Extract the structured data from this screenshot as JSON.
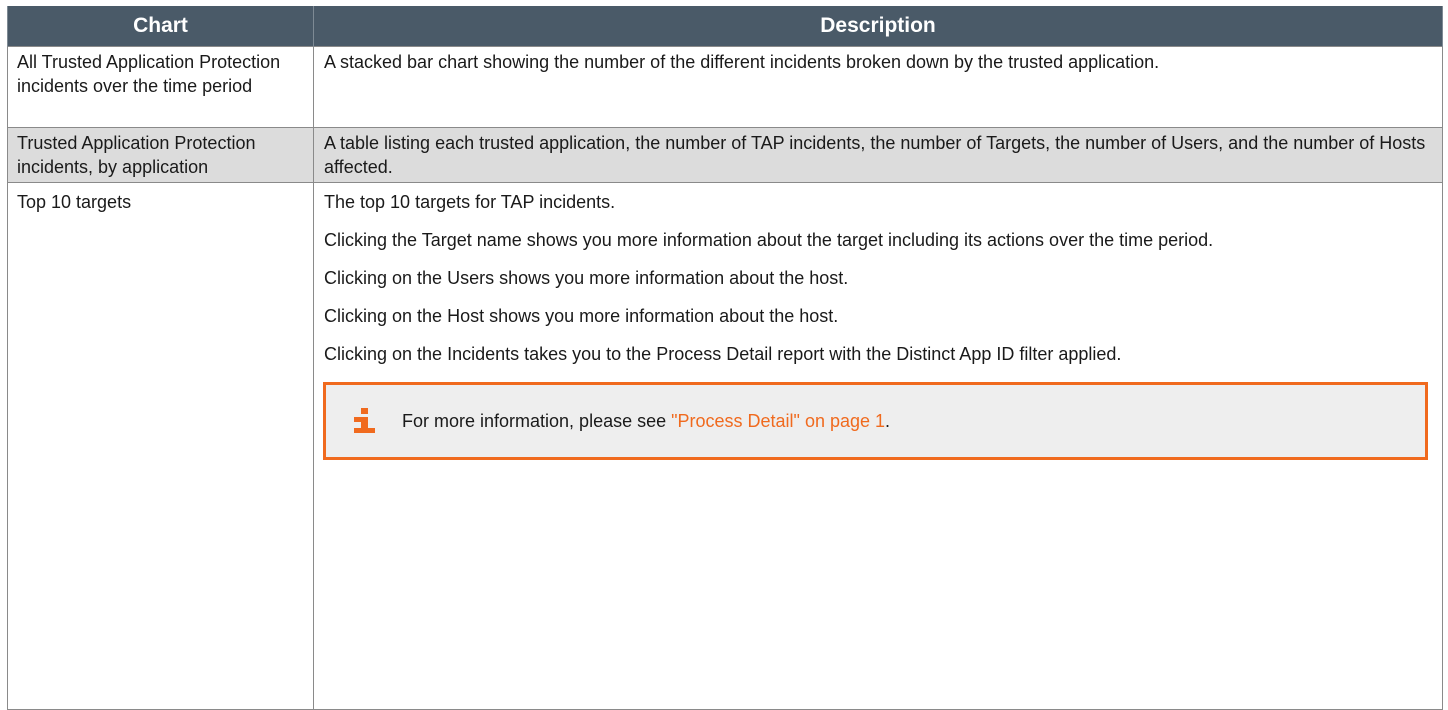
{
  "table": {
    "headers": [
      "Chart",
      "Description"
    ],
    "rows": [
      {
        "chart": "All Trusted Application Protection incidents over the time period",
        "description": [
          "A stacked bar chart showing the number of the different incidents broken down by the trusted application."
        ]
      },
      {
        "chart": "Trusted Application Protection incidents, by application",
        "description": [
          "A table listing each trusted application, the number of TAP incidents, the number of Targets, the number of Users, and the number of Hosts affected."
        ]
      },
      {
        "chart": "Top 10 targets",
        "description": [
          "The top 10 targets for TAP incidents.",
          "Clicking the Target name shows you more information about the target including its actions over the time period.",
          "Clicking on the Users shows you more information about the host.",
          "Clicking on the Host shows you more information about the host.",
          "Clicking on the Incidents takes you to the Process Detail report with the Distinct App ID filter applied."
        ],
        "note": {
          "icon": "info-icon",
          "text_before": "For more information, please see ",
          "link_text": "\"Process Detail\" on page 1",
          "text_after": "."
        }
      }
    ]
  },
  "colors": {
    "header_bg": "#4a5a68",
    "shaded_row": "#dcdcdc",
    "accent": "#f06a1e"
  }
}
